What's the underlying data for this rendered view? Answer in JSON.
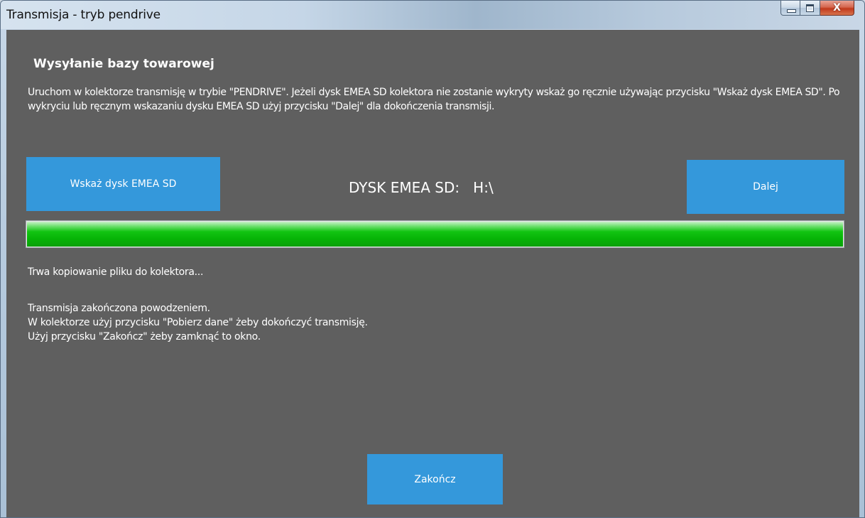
{
  "window": {
    "title": "Transmisja - tryb pendrive",
    "close_glyph": "X",
    "icons": [
      "minimize-icon",
      "maximize-icon",
      "close-icon"
    ]
  },
  "main": {
    "heading": "Wysyłanie bazy towarowej",
    "intro": "Uruchom w kolektorze transmisję w trybie \"PENDRIVE\".  Jeżeli dysk EMEA SD kolektora nie zostanie wykryty wskaż go ręcznie używając przycisku \"Wskaż dysk EMEA SD\". Po wykryciu lub ręcznym wskazaniu dysku EMEA SD użyj przycisku \"Dalej\" dla dokończenia transmisji.",
    "select_disk_button": "Wskaż dysk EMEA SD",
    "disk_label": "DYSK EMEA SD:   H:\\",
    "next_button": "Dalej",
    "progress_percent": 100,
    "status_text": "Trwa kopiowanie pliku do kolektora...",
    "result_lines": [
      "Transmisja zakończona powodzeniem.",
      "W kolektorze użyj przycisku \"Pobierz dane\" żeby dokończyć transmisję.",
      "Użyj przycisku \"Zakończ\" żeby zamknąć to okno."
    ],
    "finish_button": "Zakończ"
  },
  "colors": {
    "background": "#5f5f5f",
    "button": "#3498db",
    "progress": "#06b306",
    "text": "#ffffff"
  }
}
